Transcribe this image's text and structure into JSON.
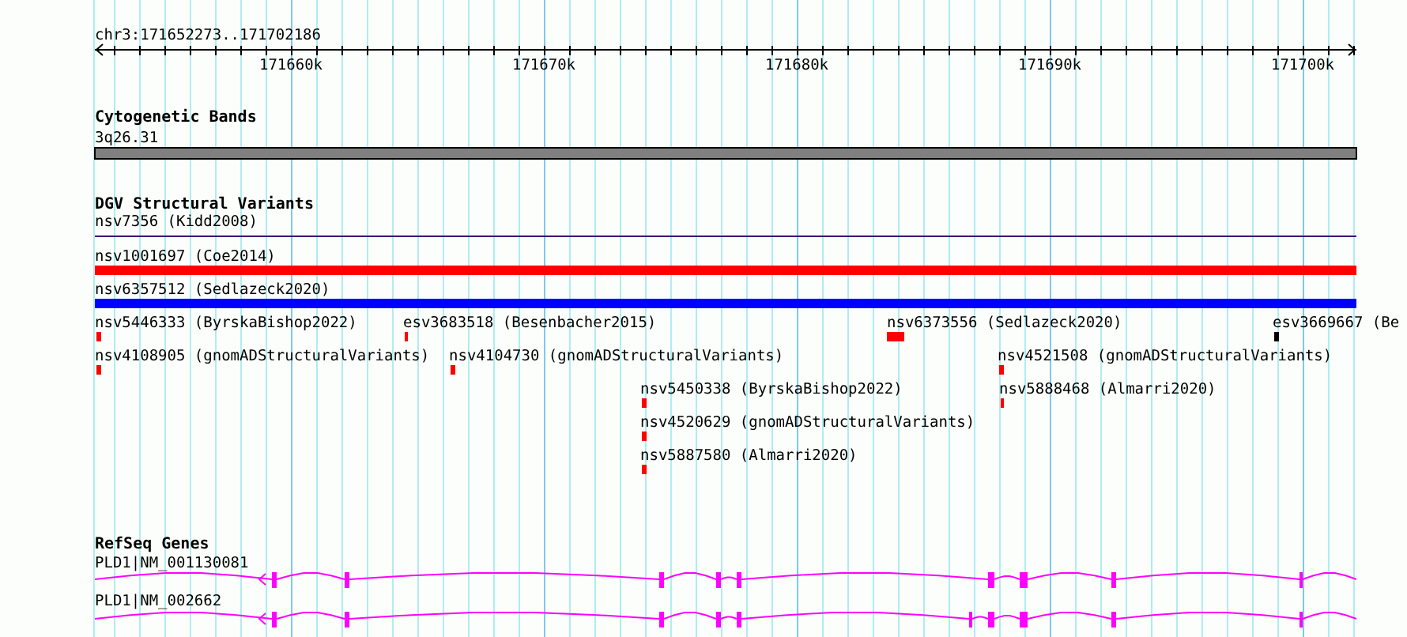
{
  "location": "chr3:171652273..171702186",
  "ruler": {
    "tick_labels": [
      "171660k",
      "171670k",
      "171680k",
      "171690k",
      "171700k"
    ]
  },
  "tracks": [
    {
      "title": "Cytogenetic Bands",
      "kind": "bands",
      "features": [
        {
          "label": "3q26.31"
        }
      ]
    },
    {
      "title": "DGV Structural Variants",
      "kind": "variants",
      "features": [
        {
          "label": "nsv7356 (Kidd2008)",
          "color": "#400070"
        },
        {
          "label": "nsv1001697 (Coe2014)",
          "color": "#ff0000"
        },
        {
          "label": "nsv6357512 (Sedlazeck2020)",
          "color": "#0000ff"
        },
        {
          "label": "nsv5446333 (ByrskaBishop2022)",
          "color": "#ff0000"
        },
        {
          "label": "esv3683518 (Besenbacher2015)",
          "color": "#ff0000"
        },
        {
          "label": "nsv6373556 (Sedlazeck2020)",
          "color": "#ff0000"
        },
        {
          "label": "esv3669667 (Be",
          "color": "#000000"
        },
        {
          "label": "nsv4108905 (gnomADStructuralVariants)",
          "color": "#ff0000"
        },
        {
          "label": "nsv4104730 (gnomADStructuralVariants)",
          "color": "#ff0000"
        },
        {
          "label": "nsv4521508 (gnomADStructuralVariants)",
          "color": "#ff0000"
        },
        {
          "label": "nsv5450338 (ByrskaBishop2022)",
          "color": "#ff0000"
        },
        {
          "label": "nsv5888468 (Almarri2020)",
          "color": "#ff0000"
        },
        {
          "label": "nsv4520629 (gnomADStructuralVariants)",
          "color": "#ff0000"
        },
        {
          "label": "nsv5887580 (Almarri2020)",
          "color": "#ff0000"
        }
      ]
    },
    {
      "title": "RefSeq Genes",
      "kind": "genes",
      "features": [
        {
          "label": "PLD1|NM_001130081"
        },
        {
          "label": "PLD1|NM_002662"
        }
      ]
    }
  ]
}
